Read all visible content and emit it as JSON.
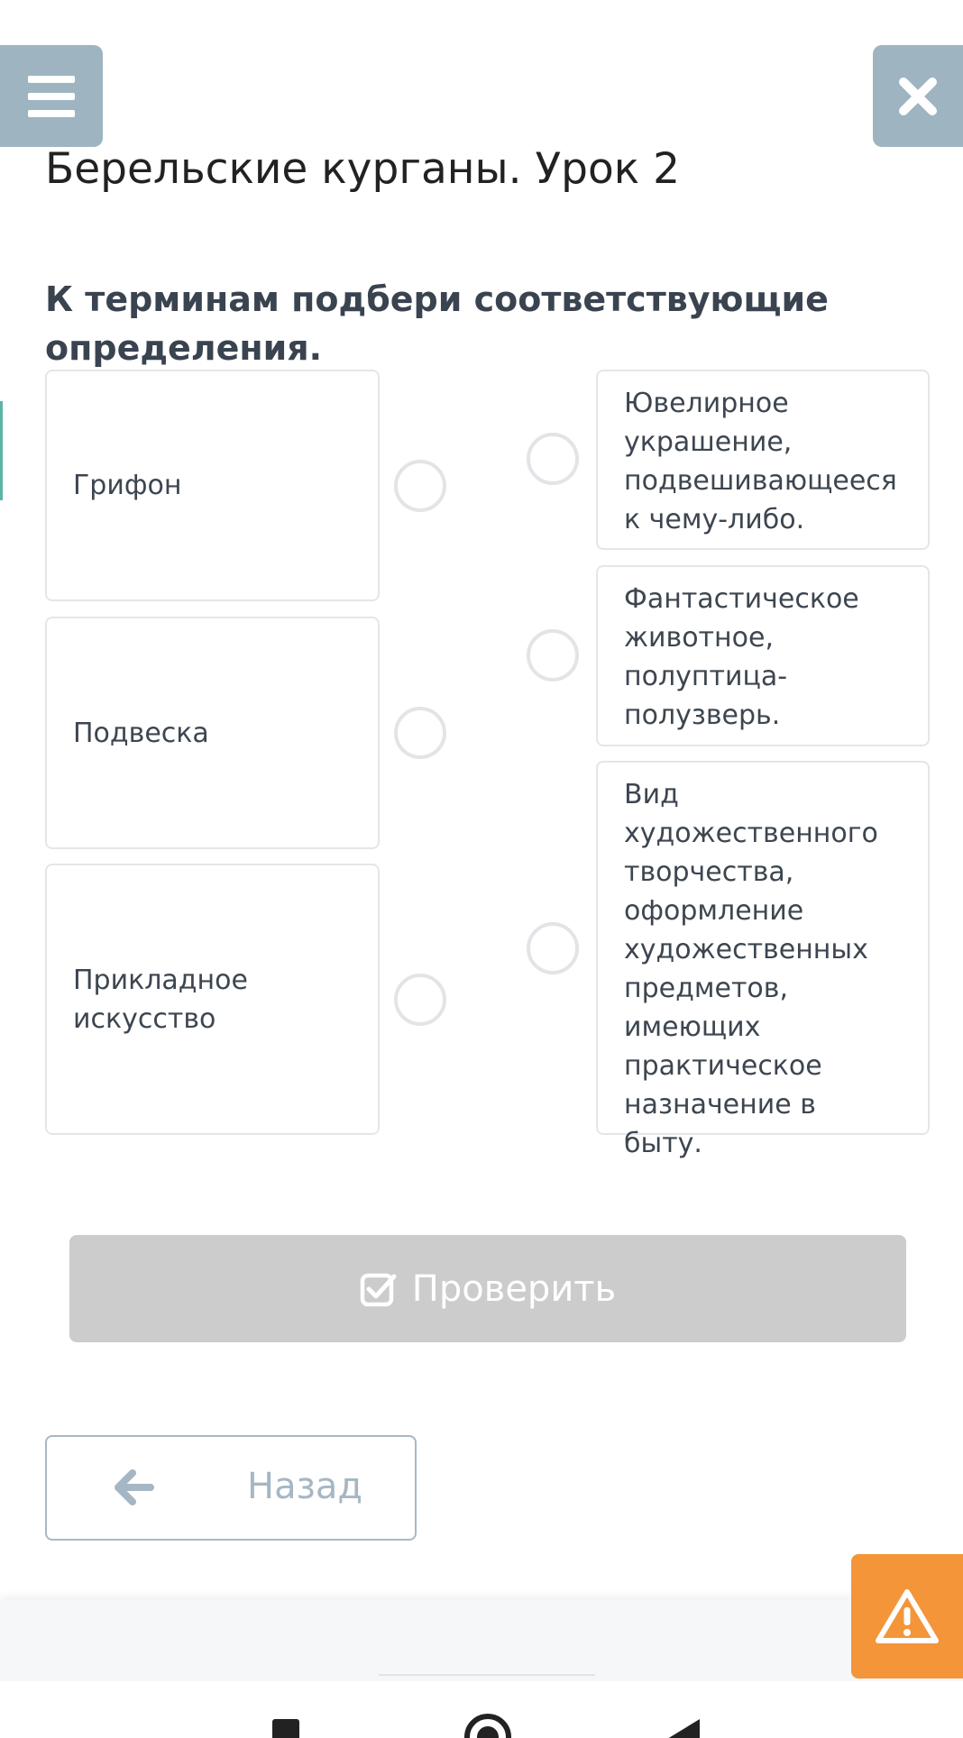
{
  "header": {
    "menu_icon": "hamburger-menu-icon",
    "close_icon": "close-icon"
  },
  "lesson": {
    "title": "Берельские курганы. Урок 2",
    "question": "К терминам подбери соответствующие определения."
  },
  "terms": [
    {
      "label": "Грифон"
    },
    {
      "label": "Подвеска"
    },
    {
      "label": "Прикладное искусство"
    }
  ],
  "definitions": [
    {
      "text": "Ювелирное украшение, подвешивающееся к чему-либо."
    },
    {
      "text": "Фантастическое животное, полуптица-полузверь."
    },
    {
      "text": "Вид художественного творчества, оформление художественных предметов, имеющих практическое назначение в быту."
    }
  ],
  "actions": {
    "check_label": "Проверить",
    "check_icon": "checkbox-check-icon",
    "back_label": "Назад",
    "back_icon": "arrow-left-icon",
    "report_icon": "warning-triangle-icon"
  },
  "colors": {
    "header_button": "#9eb4c1",
    "check_disabled": "#cccccc",
    "report_button": "#f4953a",
    "back_text": "#a5b7c4"
  }
}
